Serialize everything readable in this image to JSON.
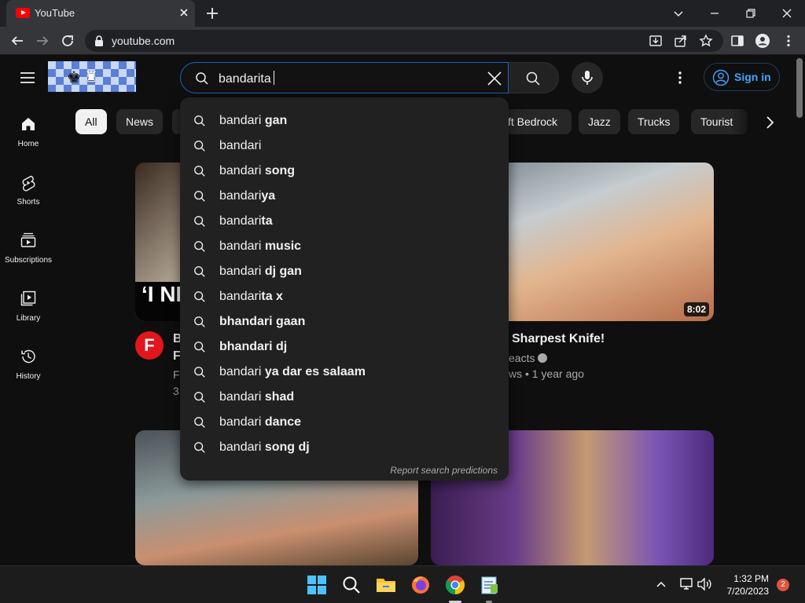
{
  "browser": {
    "tab_title": "YouTube",
    "url": "youtube.com"
  },
  "header": {
    "search_query": "bandarita",
    "sign_in_label": "Sign in"
  },
  "sidebar": {
    "items": [
      {
        "label": "Home",
        "icon": "home-icon"
      },
      {
        "label": "Shorts",
        "icon": "shorts-icon"
      },
      {
        "label": "Subscriptions",
        "icon": "subscriptions-icon"
      },
      {
        "label": "Library",
        "icon": "library-icon"
      },
      {
        "label": "History",
        "icon": "history-icon"
      }
    ]
  },
  "chips": [
    "All",
    "News",
    "ft Bedrock",
    "Jazz",
    "Trucks",
    "Tourist"
  ],
  "suggestions": [
    {
      "prefix": "bandari",
      "bold": " gan"
    },
    {
      "prefix": "bandari",
      "bold": ""
    },
    {
      "prefix": "bandari",
      "bold": " song"
    },
    {
      "prefix": "bandari",
      "bold": "ya"
    },
    {
      "prefix": "bandari",
      "bold": "ta"
    },
    {
      "prefix": "bandari",
      "bold": " music"
    },
    {
      "prefix": "bandari",
      "bold": " dj gan"
    },
    {
      "prefix": "bandari",
      "bold": "ta x"
    },
    {
      "prefix": "",
      "bold": "bhandari gaan"
    },
    {
      "prefix": "",
      "bold": "bhandari dj"
    },
    {
      "prefix": "bandari",
      "bold": " ya dar es salaam"
    },
    {
      "prefix": "bandari",
      "bold": " shad"
    },
    {
      "prefix": "bandari",
      "bold": " dance"
    },
    {
      "prefix": "bandari",
      "bold": " song dj"
    }
  ],
  "report_label": "Report search predictions",
  "videos": {
    "v1": {
      "thumb_text": "‘I NI",
      "channel_initial": "F",
      "title_line1": "B",
      "title_line2": "F",
      "meta_line1": "Fo",
      "meta_line2": "3"
    },
    "v2": {
      "duration": "8:02",
      "title": "Sharpest Knife!",
      "channel": "eacts",
      "meta": "ws • 1 year ago"
    }
  },
  "taskbar": {
    "time": "1:32 PM",
    "date": "7/20/2023",
    "notification_count": "2"
  },
  "colors": {
    "accent_blue": "#3ea6ff",
    "youtube_red": "#ff0000",
    "background": "#0f0f0f"
  }
}
